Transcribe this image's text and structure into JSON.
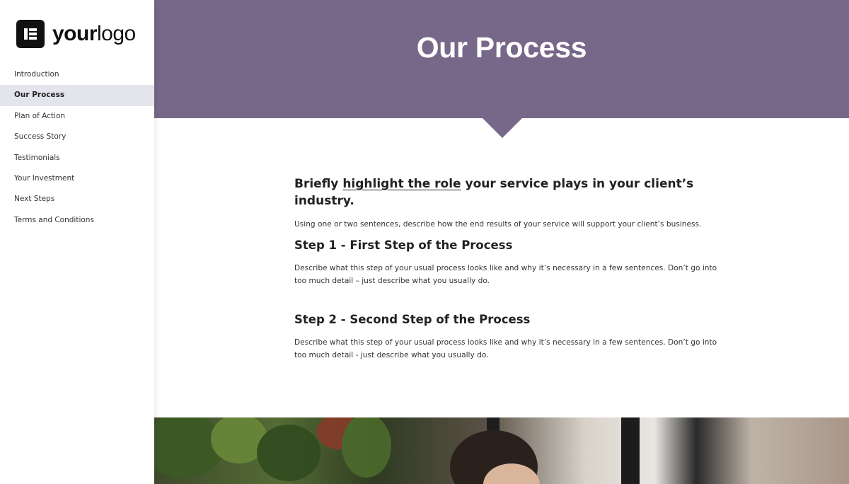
{
  "logo": {
    "text_bold": "your",
    "text_light": "logo"
  },
  "sidebar": {
    "items": [
      {
        "label": "Introduction"
      },
      {
        "label": "Our Process"
      },
      {
        "label": "Plan of Action"
      },
      {
        "label": "Success Story"
      },
      {
        "label": "Testimonials"
      },
      {
        "label": "Your Investment"
      },
      {
        "label": "Next Steps"
      },
      {
        "label": "Terms and Conditions"
      }
    ],
    "active_index": 1
  },
  "hero": {
    "title": "Our Process",
    "color": "#776789"
  },
  "intro": {
    "heading_pre": "Briefly ",
    "heading_link": "highlight the role",
    "heading_post": " your service plays in your client’s industry.",
    "text": "Using one or two sentences, describe how the end results of your service will support your client’s business."
  },
  "steps": [
    {
      "prefix": "Step 1 - ",
      "title": "First Step of the Process",
      "text": "Describe what this step of your usual process looks like and why it’s necessary in a few sentences. Don’t go into too much detail – just describe what you usually do."
    },
    {
      "prefix": "Step 2 - ",
      "title": "Second Step of the Process",
      "text": "Describe what this step of your usual process looks like and why it’s necessary in a few sentences. Don’t go into too much detail - just describe what you usually do."
    }
  ]
}
